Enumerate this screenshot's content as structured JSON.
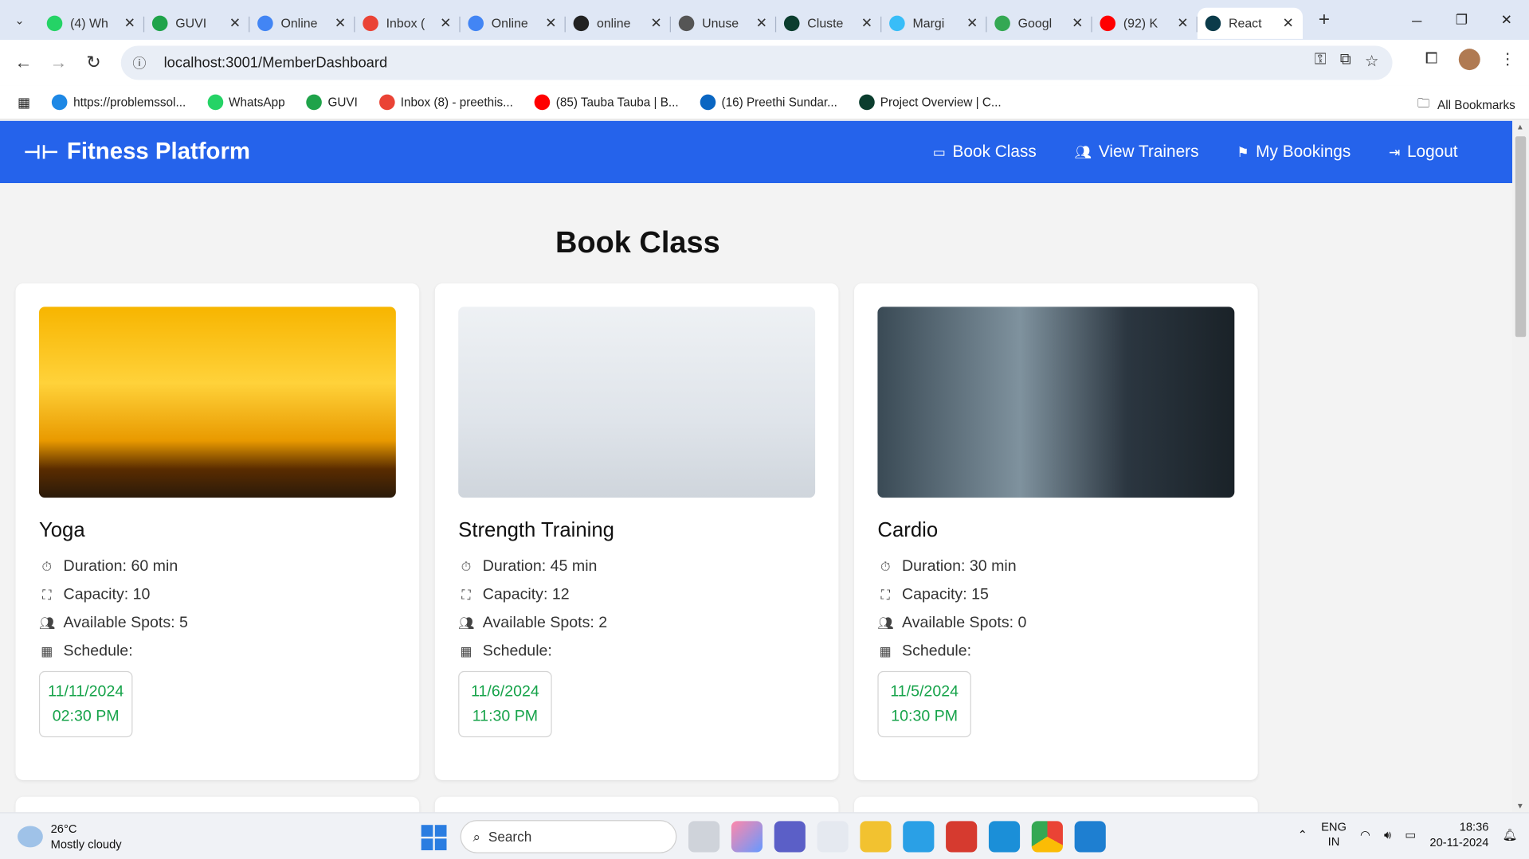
{
  "browser": {
    "tabs": [
      {
        "label": "(4) Wh",
        "color": "#25d366"
      },
      {
        "label": "GUVI",
        "color": "#1fa34a"
      },
      {
        "label": "Online",
        "color": "#4285f4"
      },
      {
        "label": "Inbox (",
        "color": "#ea4335"
      },
      {
        "label": "Online",
        "color": "#4285f4"
      },
      {
        "label": "online",
        "color": "#222222"
      },
      {
        "label": "Unuse",
        "color": "#555555"
      },
      {
        "label": "Cluste",
        "color": "#0b3d2e"
      },
      {
        "label": "Margi",
        "color": "#38bdf8"
      },
      {
        "label": "Googl",
        "color": "#34a853"
      },
      {
        "label": "(92) K",
        "color": "#ff0000"
      },
      {
        "label": "React",
        "color": "#0b3b4a"
      }
    ],
    "url": "localhost:3001/MemberDashboard",
    "bookmarks": [
      {
        "label": "https://problemssol...",
        "color": "#1e88e5"
      },
      {
        "label": "WhatsApp",
        "color": "#25d366"
      },
      {
        "label": "GUVI",
        "color": "#1fa34a"
      },
      {
        "label": "Inbox (8) - preethis...",
        "color": "#ea4335"
      },
      {
        "label": "(85) Tauba Tauba | B...",
        "color": "#ff0000"
      },
      {
        "label": "(16) Preethi Sundar...",
        "color": "#0a66c2"
      },
      {
        "label": "Project Overview | C...",
        "color": "#0b3d2e"
      }
    ],
    "all_bookmarks": "All Bookmarks"
  },
  "navbar": {
    "brand": "Fitness Platform",
    "links": [
      {
        "label": "Book Class",
        "icon": "ticket-icon"
      },
      {
        "label": "View Trainers",
        "icon": "users-icon"
      },
      {
        "label": "My Bookings",
        "icon": "bookmark-icon"
      },
      {
        "label": "Logout",
        "icon": "logout-icon"
      }
    ],
    "accent": "#2563eb"
  },
  "page": {
    "title": "Book Class"
  },
  "classes": [
    {
      "name": "Yoga",
      "duration": "Duration: 60 min",
      "capacity": "Capacity: 10",
      "spots": "Available Spots: 5",
      "schedule": "Schedule:",
      "date": "11/11/2024",
      "time": "02:30 PM"
    },
    {
      "name": "Strength Training",
      "duration": "Duration: 45 min",
      "capacity": "Capacity: 12",
      "spots": "Available Spots: 2",
      "schedule": "Schedule:",
      "date": "11/6/2024",
      "time": "11:30 PM"
    },
    {
      "name": "Cardio",
      "duration": "Duration: 30 min",
      "capacity": "Capacity: 15",
      "spots": "Available Spots: 0",
      "schedule": "Schedule:",
      "date": "11/5/2024",
      "time": "10:30 PM"
    }
  ],
  "taskbar": {
    "temperature": "26°C",
    "weather": "Mostly cloudy",
    "search": "Search",
    "lang1": "ENG",
    "lang2": "IN",
    "time": "18:36",
    "date": "20-11-2024"
  }
}
